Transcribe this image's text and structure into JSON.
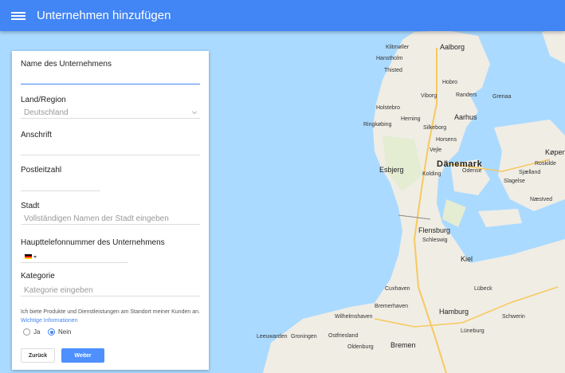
{
  "header": {
    "title": "Unternehmen hinzufügen",
    "menu_icon": "hamburger-menu-icon"
  },
  "form": {
    "name_label": "Name des Unternehmens",
    "name_value": "",
    "country_label": "Land/Region",
    "country_value": "Deutschland",
    "address_label": "Anschrift",
    "address_value": "",
    "zip_label": "Postleitzahl",
    "zip_value": "",
    "city_label": "Stadt",
    "city_placeholder": "Vollständigen Namen der Stadt eingeben",
    "phone_label": "Haupttelefonnummer des Unternehmens",
    "category_label": "Kategorie",
    "category_placeholder": "Kategorie eingeben",
    "note_text": "Ich biete Produkte und Dienstleistungen am Standort meiner Kunden an.",
    "note_link": "Wichtige Informationen",
    "radio_yes": "Ja",
    "radio_no": "Nein",
    "radio_selected": "Nein",
    "back_button": "Zurück",
    "next_button": "Weiter"
  },
  "map": {
    "country_label": "Dänemark",
    "places": [
      "Klitmøller",
      "Aalborg",
      "Hanstholm",
      "Thisted",
      "Hobro",
      "Randers",
      "Viborg",
      "Grenaa",
      "Holstebro",
      "Herning",
      "Aarhus",
      "Ringkøbing",
      "Silkeborg",
      "Horsens",
      "Vejle",
      "Køpen",
      "Esbjerg",
      "Kolding",
      "Odense",
      "Roskilde",
      "Sjælland",
      "Slagelse",
      "Næstved",
      "Flensburg",
      "Schleswig",
      "Kiel",
      "Lübeck",
      "Cuxhaven",
      "Wilhelmshaven",
      "Hamburg",
      "Schwerin",
      "Bremerhaven",
      "Leeuwarden",
      "Groningen",
      "Oldenburg",
      "Lüneburg",
      "Bremen",
      "Ostfriesland"
    ],
    "water_color": "#aadaff",
    "land_color": "#f0ede5"
  },
  "colors": {
    "accent": "#4285f4"
  }
}
